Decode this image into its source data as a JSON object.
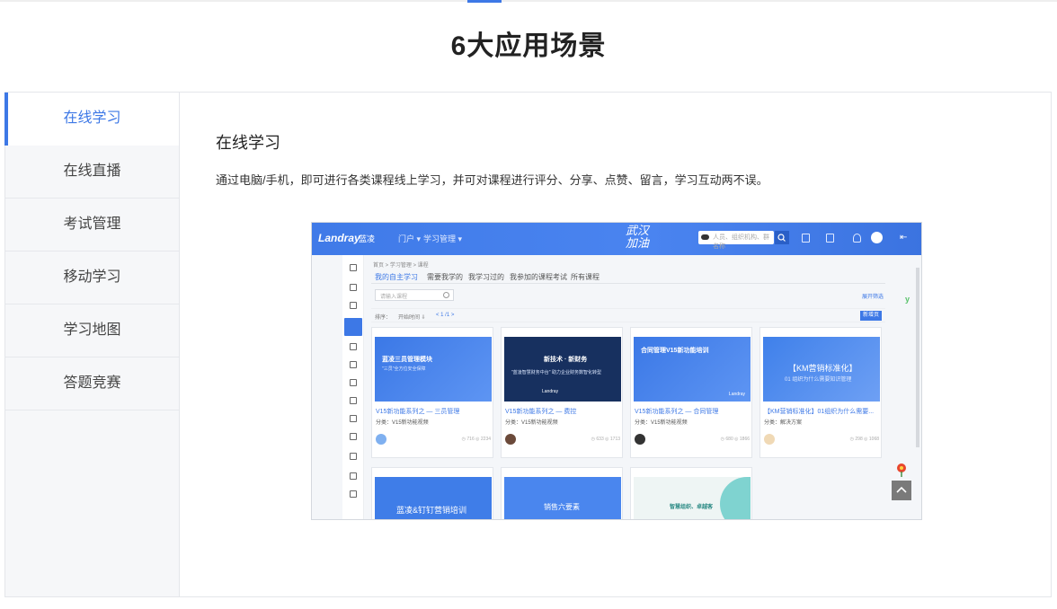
{
  "page": {
    "heading": "6大应用场景"
  },
  "tabs": [
    {
      "label": "在线学习",
      "active": true
    },
    {
      "label": "在线直播",
      "active": false
    },
    {
      "label": "考试管理",
      "active": false
    },
    {
      "label": "移动学习",
      "active": false
    },
    {
      "label": "学习地图",
      "active": false
    },
    {
      "label": "答题竞赛",
      "active": false
    }
  ],
  "content": {
    "title": "在线学习",
    "description": "通过电脑/手机，即可进行各类课程线上学习，并可对课程进行评分、分享、点赞、留言，学习互动两不误。"
  },
  "screenshot": {
    "logo": "Landray",
    "logo_sub": "蓝凌",
    "nav": [
      "门户 ▾",
      "学习管理 ▾"
    ],
    "banner": "武汉加油",
    "search_placeholder": "人员、组织机构、群名称",
    "breadcrumb": "首页 > 学习管理 > 课程",
    "sub_tabs": [
      "我的自主学习",
      "需要我学的",
      "我学习过的",
      "我参加的课程考试",
      "所有课程"
    ],
    "filter_placeholder": "请输入课程",
    "share_link": "展开筛选",
    "sort_label": "排序：",
    "sort_value": "开始时间 ⇩",
    "pager": "< 1 /1 >",
    "sort_button": "新增页",
    "cards": [
      {
        "img_title": "蓝凌三员管理模块",
        "img_sub": "\"三员\"全方位安全保障",
        "img_brand": "",
        "title": "V15新功能系列之 — 三员管理",
        "category": "分类：V15新功能视频",
        "stats": "◷ 716  ◎ 2234",
        "bg": "#3f7de8"
      },
      {
        "img_title": "新技术 · 新财务",
        "img_sub": "\"蓝凌智慧财务中台\" 助力企业财务数智化转型",
        "img_brand": "Landray",
        "title": "V15新功能系列之 — 费控",
        "category": "分类：V15新功能视频",
        "stats": "◷ 633  ◎ 1713",
        "bg": "#17305f"
      },
      {
        "img_title": "合同管理V15新功能培训",
        "img_sub": "",
        "img_brand": "Landray",
        "title": "V15新功能系列之 — 合同管理",
        "category": "分类：V15新功能视频",
        "stats": "◷ 680  ◎ 1866",
        "bg": "#3f7de8"
      },
      {
        "img_title": "【KM营销标准化】",
        "img_sub": "01 组织为什么需要知识管理",
        "img_brand": "",
        "title": "【KM营销标准化】01组织为什么需要...",
        "category": "分类：解决方案",
        "stats": "◷ 298  ◎ 1068",
        "bg": "#4585ee"
      },
      {
        "img_title": "蓝凌&钉钉营销培训",
        "img_sub": "",
        "img_brand": "",
        "title": "",
        "category": "",
        "stats": "",
        "bg": "#3f7de8"
      },
      {
        "img_title": "销售六要素",
        "img_sub": "",
        "img_brand": "",
        "title": "",
        "category": "",
        "stats": "",
        "bg": "#4a86ee"
      },
      {
        "img_title": "智慧组织、卓越客",
        "img_sub": "",
        "img_brand": "",
        "title": "",
        "category": "",
        "stats": "",
        "bg": "#eef5f4"
      }
    ]
  }
}
